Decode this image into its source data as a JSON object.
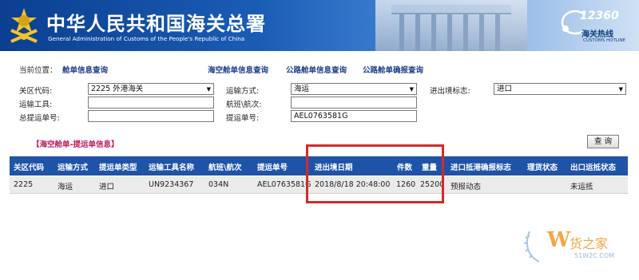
{
  "banner": {
    "title_cn": "中华人民共和国海关总署",
    "title_en": "General Administration of Customs of the People's Republic of China",
    "hotline_number": "12360",
    "hotline_cn": "海关热线",
    "hotline_en": "CUSTOMS HOTLINE"
  },
  "breadcrumb": {
    "label": "当前位置：",
    "current": "舱单信息查询",
    "links": [
      "海空舱单信息查询",
      "公路舱单信息查询",
      "公路舱单确报查询"
    ]
  },
  "form": {
    "customs_code_label": "关区代码:",
    "customs_code_value": "2225 外港海关",
    "transport_mode_label": "运输方式:",
    "transport_mode_value": "海运",
    "io_flag_label": "进出境标志:",
    "io_flag_value": "进口",
    "vehicle_label": "运输工具:",
    "vehicle_value": "",
    "voyage_label": "航班\\航次:",
    "voyage_value": "",
    "master_bill_label": "总提运单号:",
    "master_bill_value": "",
    "bill_label": "提运单号:",
    "bill_value": "AEL0763581G"
  },
  "section_title": "【海空舱单-提运单信息】",
  "query_button": "查 询",
  "table": {
    "headers": [
      "关区代码",
      "运输方式",
      "提运单类型",
      "运输工具名称",
      "航班\\航次",
      "提运单号",
      "进出境日期",
      "件数",
      "重量",
      "进口抵港确报标志",
      "理货状态",
      "出口运抵状态"
    ],
    "rows": [
      [
        "2225",
        "海运",
        "进口",
        "UN9234367",
        "034N",
        "AEL0763581G",
        "2018/8/18 20:48:00",
        "1260",
        "25200",
        "预报动态",
        "",
        "未运抵"
      ]
    ]
  },
  "watermark": {
    "brand": "货之家",
    "url": "51W2C.COM"
  },
  "colors": {
    "banner_blue": "#1a5cb5",
    "header_blue": "#1e53a7",
    "highlight_red": "#d42a2a",
    "section_pink": "#c0195f",
    "link_navy": "#1d3e8a"
  }
}
